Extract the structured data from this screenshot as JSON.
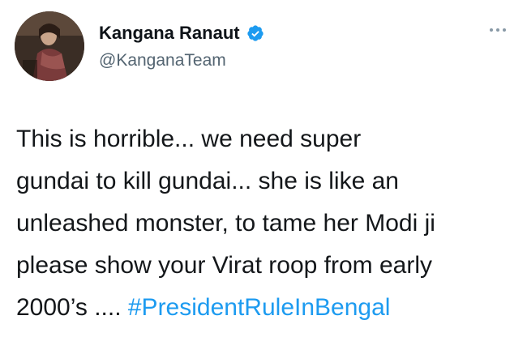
{
  "tweet": {
    "author": {
      "display_name": "Kangana Ranaut",
      "handle": "@KanganaTeam",
      "verified": true,
      "verified_color": "#1d9bf0"
    },
    "more_icon": "more-options-icon",
    "text_lines": [
      "This is horrible... we need super",
      "gundai to kill gundai... she is like an",
      "unleashed monster, to tame her Modi ji",
      "please show your Virat roop from early",
      "2000’s .... "
    ],
    "hashtag": "#PresidentRuleInBengal",
    "hashtag_color": "#1d9bf0"
  }
}
